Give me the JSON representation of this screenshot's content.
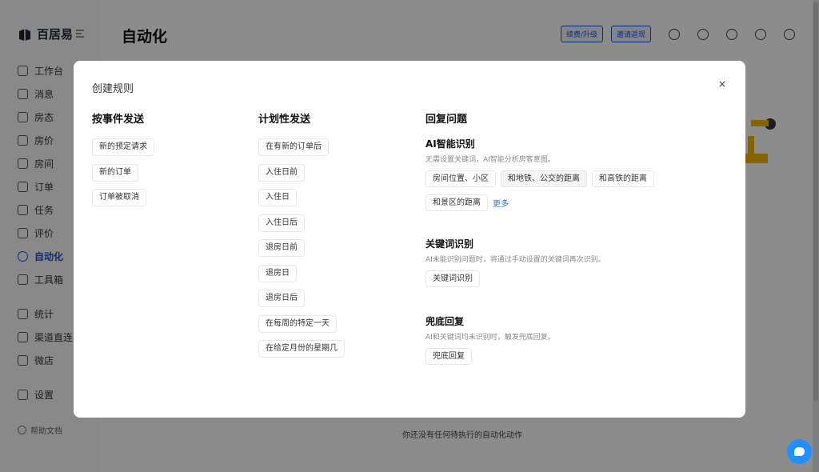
{
  "app": {
    "logo_text": "百居易",
    "page_title": "自动化",
    "top_buttons": [
      "续费/升级",
      "邀请返现"
    ],
    "nav": [
      {
        "label": "工作台",
        "icon": "grid-icon"
      },
      {
        "label": "消息",
        "icon": "message-icon"
      },
      {
        "label": "房态",
        "icon": "calendar-icon"
      },
      {
        "label": "房价",
        "icon": "tag-icon"
      },
      {
        "label": "房间",
        "icon": "room-icon"
      },
      {
        "label": "订单",
        "icon": "order-icon"
      },
      {
        "label": "任务",
        "icon": "task-icon"
      },
      {
        "label": "评价",
        "icon": "star-icon"
      },
      {
        "label": "自动化",
        "icon": "automation-icon",
        "active": true
      },
      {
        "label": "工具箱",
        "icon": "toolbox-icon"
      }
    ],
    "nav2": [
      {
        "label": "统计",
        "icon": "stats-icon"
      },
      {
        "label": "渠道直连",
        "icon": "channel-icon"
      },
      {
        "label": "微店",
        "icon": "shop-icon"
      }
    ],
    "nav3": [
      {
        "label": "设置",
        "icon": "settings-icon"
      }
    ],
    "help_label": "帮助文档",
    "empty_text": "你还没有任何待执行的自动化动作",
    "accent": "#1d4ed8"
  },
  "modal": {
    "title": "创建规则",
    "close_label": "×",
    "event": {
      "heading": "按事件发送",
      "items": [
        "新的预定请求",
        "新的订单",
        "订单被取消"
      ]
    },
    "schedule": {
      "heading": "计划性发送",
      "items": [
        "在有新的订单后",
        "入住日前",
        "入住日",
        "入住日后",
        "退房日前",
        "退房日",
        "退房日后",
        "在每周的特定一天",
        "在给定月份的星期几"
      ]
    },
    "reply": {
      "heading": "回复问题",
      "ai": {
        "title": "AI智能识别",
        "desc": "无需设置关键词，AI智能分析房客意图。",
        "chips": [
          "房间位置、小区",
          "和地铁、公交的距离",
          "和高铁的距离",
          "和景区的距离"
        ],
        "more": "更多"
      },
      "keyword": {
        "title": "关键词识别",
        "desc": "AI未能识别问题时，将通过手动设置的关键词再次识别。",
        "chips": [
          "关键词识别"
        ]
      },
      "fallback": {
        "title": "兜底回复",
        "desc": "AI和关键词均未识别时，触发兜底回复。",
        "chips": [
          "兜底回复"
        ]
      }
    }
  }
}
